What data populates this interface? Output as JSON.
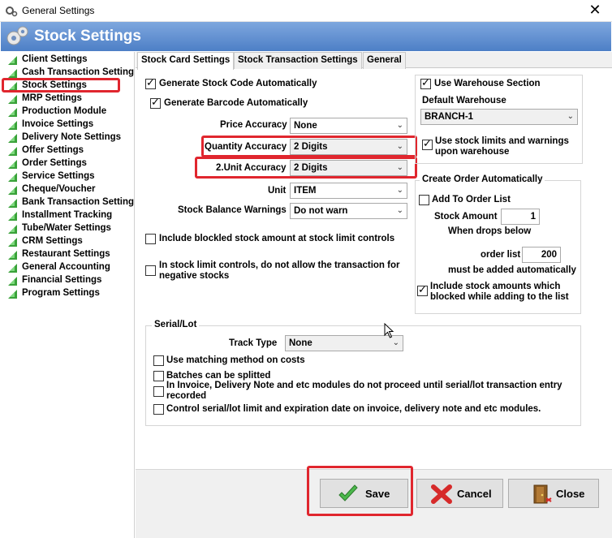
{
  "window": {
    "title": "General Settings",
    "close_glyph": "✕"
  },
  "banner": {
    "title": "Stock Settings",
    "icon": "gears-icon"
  },
  "sidebar": {
    "items": [
      {
        "label": "Client Settings"
      },
      {
        "label": "Cash Transaction Settings"
      },
      {
        "label": "Stock Settings"
      },
      {
        "label": "MRP Settings"
      },
      {
        "label": "Production Module"
      },
      {
        "label": "Invoice Settings"
      },
      {
        "label": "Delivery Note Settings"
      },
      {
        "label": "Offer Settings"
      },
      {
        "label": "Order Settings"
      },
      {
        "label": "Service Settings"
      },
      {
        "label": "Cheque/Voucher"
      },
      {
        "label": "Bank Transaction Settings"
      },
      {
        "label": "Installment Tracking"
      },
      {
        "label": "Tube/Water Settings"
      },
      {
        "label": "CRM Settings"
      },
      {
        "label": "Restaurant Settings"
      },
      {
        "label": "General Accounting"
      },
      {
        "label": "Financial Settings"
      },
      {
        "label": "Program Settings"
      }
    ],
    "selected": "Stock Settings"
  },
  "tabs": [
    {
      "label": "Stock Card Settings",
      "active": true
    },
    {
      "label": "Stock Transaction Settings",
      "active": false
    },
    {
      "label": "General",
      "active": false
    }
  ],
  "stock_card": {
    "gen_stock_code": {
      "label": "Generate Stock Code Automatically",
      "checked": true
    },
    "gen_barcode": {
      "label": "Generate Barcode Automatically",
      "checked": true
    },
    "price_accuracy": {
      "label": "Price Accuracy",
      "value": "None"
    },
    "quantity_accuracy": {
      "label": "Quantity Accuracy",
      "value": "2 Digits"
    },
    "unit2_accuracy": {
      "label": "2.Unit Accuracy",
      "value": "2 Digits"
    },
    "unit": {
      "label": "Unit",
      "value": "ITEM"
    },
    "stock_balance_warnings": {
      "label": "Stock Balance Warnings",
      "value": "Do not warn"
    },
    "include_blocked": {
      "label": "Include blockled stock amount at stock limit controls",
      "checked": false
    },
    "no_negative": {
      "label": "In stock limit controls, do not allow the transaction for negative stocks",
      "checked": false
    }
  },
  "warehouse": {
    "use_section": {
      "label": "Use Warehouse Section",
      "checked": true
    },
    "default_label": "Default Warehouse",
    "default_value": "BRANCH-1",
    "use_limits": {
      "label": "Use stock limits and warnings upon warehouse",
      "checked": true
    }
  },
  "create_order": {
    "title": "Create Order Automatically",
    "add_to_list": {
      "label": "Add To Order List",
      "checked": false
    },
    "stock_amount_label": "Stock Amount",
    "stock_amount_value": "1",
    "when_drops": "When drops below",
    "order_list_label": "order list",
    "order_list_value": "200",
    "must_be_added": "must be added automatically",
    "include_blocked": {
      "label": "Include stock amounts which blocked while adding to the list",
      "checked": true
    }
  },
  "serial_lot": {
    "title": "Serial/Lot",
    "track_type_label": "Track Type",
    "track_type_value": "None",
    "matching": {
      "label": "Use matching method on costs",
      "checked": false
    },
    "batches": {
      "label": "Batches can be splitted",
      "checked": false
    },
    "invoice_note": {
      "label": "In Invoice, Delivery Note and etc modules do not proceed until serial/lot transaction entry recorded",
      "checked": false
    },
    "control_limit": {
      "label": "Control serial/lot limit and expiration date on invoice, delivery note and etc modules.",
      "checked": false
    }
  },
  "buttons": {
    "save": "Save",
    "cancel": "Cancel",
    "close": "Close"
  },
  "colors": {
    "banner": "#4d7fc6",
    "highlight": "#e0262e",
    "tree_triangle": "#3aa23a"
  }
}
